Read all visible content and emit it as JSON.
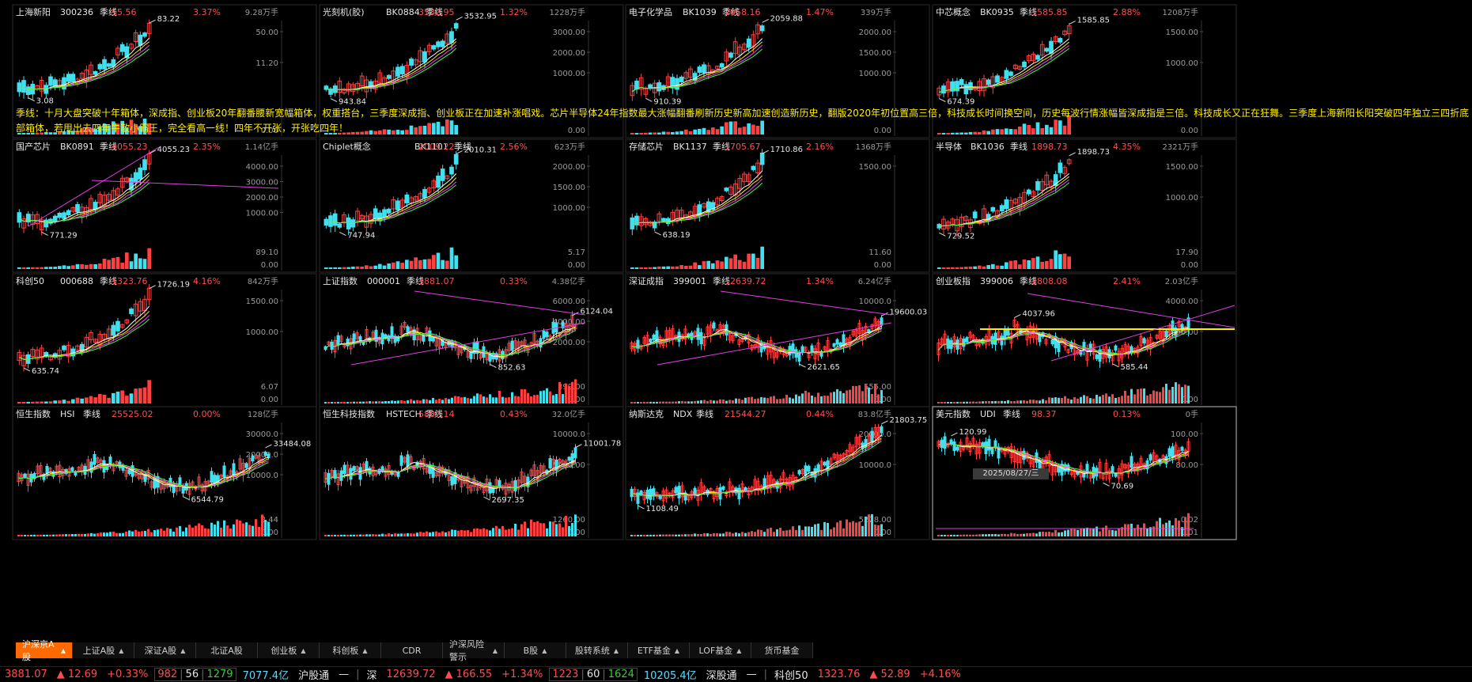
{
  "panels": [
    {
      "name": "上海新阳",
      "code": "300236",
      "period": "季线",
      "price": "55.56",
      "pct": "3.37%",
      "vol": "9.28万手",
      "hi_label": "83.22",
      "lo_label": "3.08",
      "y1": "50.00",
      "y2": "11.20",
      "y0": "0.00"
    },
    {
      "name": "光刻机(胶)",
      "code": "BK0884",
      "period": "季线",
      "price": "3532.95",
      "pct": "1.32%",
      "vol": "1228万手",
      "hi_label": "3532.95",
      "lo_label": "943.84",
      "y1": "3000.00",
      "y2": "2000.00",
      "y3": "1000.00",
      "y0": "0.00"
    },
    {
      "name": "电子化学品",
      "code": "BK1039",
      "period": "季线",
      "price": "2058.16",
      "pct": "1.47%",
      "vol": "339万手",
      "hi_label": "2059.88",
      "lo_label": "910.39",
      "y1": "2000.00",
      "y2": "1500.00",
      "y3": "1000.00",
      "y0": "0.00"
    },
    {
      "name": "中芯概念",
      "code": "BK0935",
      "period": "季线",
      "price": "1585.85",
      "pct": "2.88%",
      "vol": "1208万手",
      "hi_label": "1585.85",
      "lo_label": "674.39",
      "y1": "1500.00",
      "y2": "1000.00",
      "y0": "0.00"
    },
    {
      "name": "国产芯片",
      "code": "BK0891",
      "period": "季线",
      "price": "4055.23",
      "pct": "2.35%",
      "vol": "1.14亿手",
      "hi_label": "4055.23",
      "lo_label": "771.29",
      "y1": "4000.00",
      "y2": "3000.00",
      "y3": "2000.00",
      "y4": "1000.00",
      "v1": "89.10",
      "y0": "0.00"
    },
    {
      "name": "Chiplet概念",
      "code": "BK1101",
      "period": "季线",
      "price": "2009.22",
      "pct": "2.56%",
      "vol": "623万手",
      "hi_label": "2010.31",
      "lo_label": "747.94",
      "y1": "2000.00",
      "y2": "1500.00",
      "y3": "1000.00",
      "v1": "5.17",
      "y0": "0.00"
    },
    {
      "name": "存储芯片",
      "code": "BK1137",
      "period": "季线",
      "price": "1705.67",
      "pct": "2.16%",
      "vol": "1368万手",
      "hi_label": "1710.86",
      "lo_label": "638.19",
      "y1": "1500.00",
      "v1": "11.60",
      "y0": "0.00"
    },
    {
      "name": "半导体",
      "code": "BK1036",
      "period": "季线",
      "price": "1898.73",
      "pct": "4.35%",
      "vol": "2321万手",
      "hi_label": "1898.73",
      "lo_label": "729.52",
      "y1": "1500.00",
      "y2": "1000.00",
      "v1": "17.90",
      "y0": "0.00"
    },
    {
      "name": "科创50",
      "code": "000688",
      "period": "季线",
      "price": "1323.76",
      "pct": "4.16%",
      "vol": "842万手",
      "hi_label": "1726.19",
      "lo_label": "635.74",
      "y1": "1500.00",
      "y2": "1000.00",
      "v1": "6.07",
      "y0": "0.00"
    },
    {
      "name": "上证指数",
      "code": "000001",
      "period": "季线",
      "price": "3881.07",
      "pct": "0.33%",
      "vol": "4.38亿手",
      "hi_label": "6124.04",
      "lo_label": "852.63",
      "y1": "6000.00",
      "y2": "4000.00",
      "y3": "2000.00",
      "v1": "399.00",
      "y0": "0.00"
    },
    {
      "name": "深证成指",
      "code": "399001",
      "period": "季线",
      "price": "12639.72",
      "pct": "1.34%",
      "vol": "6.24亿手",
      "hi_label": "19600.03",
      "lo_label": "2621.65",
      "y1": "10000.0",
      "v1": "555.00",
      "y0": "0.00"
    },
    {
      "name": "创业板指",
      "code": "399006",
      "period": "季线",
      "price": "2808.08",
      "pct": "2.41%",
      "vol": "2.03亿手",
      "hi_label": "4037.96",
      "lo_label": "585.44",
      "y1": "4000.00",
      "y2": "2000.00",
      "y0": "0.00"
    },
    {
      "name": "恒生指数",
      "code": "HSI",
      "period": "季线",
      "price": "25525.02",
      "pct": "0.00%",
      "vol": "128亿手",
      "hi_label": "33484.08",
      "lo_label": "6544.79",
      "y1": "30000.0",
      "y2": "20000.0",
      "y3": "10000.0",
      "v1": "2.44",
      "y0": "0.00"
    },
    {
      "name": "恒生科技指数",
      "code": "HSTECH",
      "period": "季线",
      "price": "5807.14",
      "pct": "0.43%",
      "vol": "32.0亿手",
      "hi_label": "11001.78",
      "lo_label": "2697.35",
      "y1": "10000.0",
      "y2": "5000.00",
      "v1": "1260.00",
      "y0": "0.00"
    },
    {
      "name": "纳斯达克",
      "code": "NDX",
      "period": "季线",
      "price": "21544.27",
      "pct": "0.44%",
      "vol": "83.8亿手",
      "hi_label": "21803.75",
      "lo_label": "1108.49",
      "y1": "20000.0",
      "y2": "10000.0",
      "v1": "5228.00",
      "y0": "0.00"
    },
    {
      "name": "美元指数",
      "code": "UDI",
      "period": "季线",
      "price": "98.37",
      "pct": "0.13%",
      "vol": "0手",
      "hi_label": "120.99",
      "lo_label": "70.69",
      "y1": "100.00",
      "y2": "80.00",
      "v1": "0.02",
      "y0": "-0.01"
    }
  ],
  "date_tag": "2025/08/27/三",
  "note": "季线：十月大盘突破十年箱体，深成指、创业板20年翻番腰新宽幅箱体，权重搭台，三季度深成指、创业板正在加速补涨唱戏。芯片半导体24年指数最大涨幅翻番刷新历史新高加速创造新历史，翻版2020年初位置高三倍，科技成长时间换空间，历史每波行情涨幅皆深成指是三倍。科技成长又正在狂舞。三季度上海新阳长阳突破四年独立三四折底部箱体，若甩出去四年牛散小霸王，完全看高一线！四年不开张，开张吃四年！",
  "tabs": [
    {
      "label": "沪深京A股",
      "caret": true,
      "active": true
    },
    {
      "label": "上证A股",
      "caret": true
    },
    {
      "label": "深证A股",
      "caret": true
    },
    {
      "label": "北证A股",
      "caret": false
    },
    {
      "label": "创业板",
      "caret": true
    },
    {
      "label": "科创板",
      "caret": true
    },
    {
      "label": "CDR",
      "caret": false
    },
    {
      "label": "沪深风险警示",
      "caret": true
    },
    {
      "label": "B股",
      "caret": true
    },
    {
      "label": "股转系统",
      "caret": true
    },
    {
      "label": "ETF基金",
      "caret": true
    },
    {
      "label": "LOF基金",
      "caret": true
    },
    {
      "label": "货币基金",
      "caret": false
    }
  ],
  "status": {
    "sh_price": "3881.07",
    "sh_chg": "▲ 12.69",
    "sh_pct": "+0.33%",
    "sh_up": "982",
    "sh_flat": "56",
    "sh_down": "1279",
    "sh_amount": "7077.4亿",
    "hgt_label": "沪股通",
    "hgt_val": "—",
    "sz_label": "深",
    "sz_price": "12639.72",
    "sz_chg": "▲ 166.55",
    "sz_pct": "+1.34%",
    "sz_up": "1223",
    "sz_flat": "60",
    "sz_down": "1624",
    "sz_amount": "10205.4亿",
    "sgt_label": "深股通",
    "sgt_val": "—",
    "kc_label": "科创50",
    "kc_price": "1323.76",
    "kc_chg": "▲ 52.89",
    "kc_pct": "+4.16%"
  }
}
